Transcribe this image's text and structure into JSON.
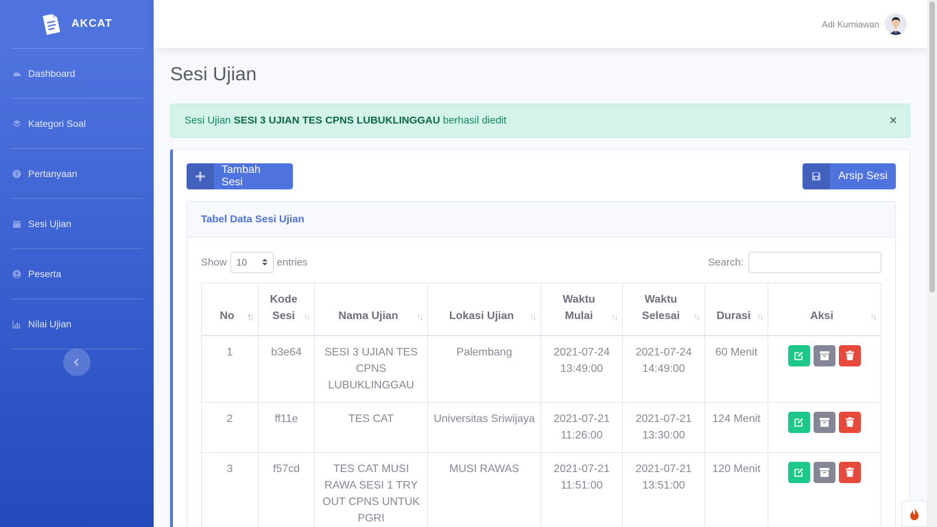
{
  "brand": {
    "name": "AKCAT"
  },
  "sidebar": {
    "items": [
      {
        "label": "Dashboard",
        "icon": "dashboard-icon"
      },
      {
        "label": "Kategori Soal",
        "icon": "layers-icon"
      },
      {
        "label": "Pertanyaan",
        "icon": "question-icon"
      },
      {
        "label": "Sesi Ujian",
        "icon": "calendar-icon"
      },
      {
        "label": "Peserta",
        "icon": "user-circle-icon"
      },
      {
        "label": "Nilai Ujian",
        "icon": "chart-icon"
      }
    ]
  },
  "topbar": {
    "user_name": "Adi Kurniawan"
  },
  "page": {
    "title": "Sesi Ujian"
  },
  "alert": {
    "prefix": "Sesi Ujian ",
    "name": "SESI 3 UJIAN TES CPNS LUBUKLINGGAU",
    "suffix": " berhasil diedit",
    "close": "×"
  },
  "buttons": {
    "add": "Tambah Sesi",
    "archive": "Arsip Sesi"
  },
  "table_card": {
    "title": "Tabel Data Sesi Ujian",
    "show_label": "Show",
    "entries_label": "entries",
    "page_length": "10",
    "search_label": "Search:"
  },
  "table": {
    "headers": [
      "No",
      "Kode Sesi",
      "Nama Ujian",
      "Lokasi Ujian",
      "Waktu Mulai",
      "Waktu Selesai",
      "Durasi",
      "Aksi"
    ],
    "rows": [
      {
        "no": "1",
        "kode": "b3e64",
        "nama": "SESI 3 UJIAN TES CPNS LUBUKLINGGAU",
        "lokasi": "Palembang",
        "mulai": "2021-07-24 13:49:00",
        "selesai": "2021-07-24 14:49:00",
        "durasi": "60 Menit"
      },
      {
        "no": "2",
        "kode": "ff11e",
        "nama": "TES CAT",
        "lokasi": "Universitas Sriwijaya",
        "mulai": "2021-07-21 11:26:00",
        "selesai": "2021-07-21 13:30:00",
        "durasi": "124 Menit"
      },
      {
        "no": "3",
        "kode": "f57cd",
        "nama": "TES CAT MUSI RAWA SESI 1 TRY OUT CPNS UNTUK PGRI",
        "lokasi": "MUSI RAWAS",
        "mulai": "2021-07-21 11:51:00",
        "selesai": "2021-07-21 13:51:00",
        "durasi": "120 Menit"
      }
    ]
  },
  "colors": {
    "primary": "#4e73df",
    "success": "#1cc88a",
    "secondary": "#858796",
    "danger": "#e74a3b"
  }
}
